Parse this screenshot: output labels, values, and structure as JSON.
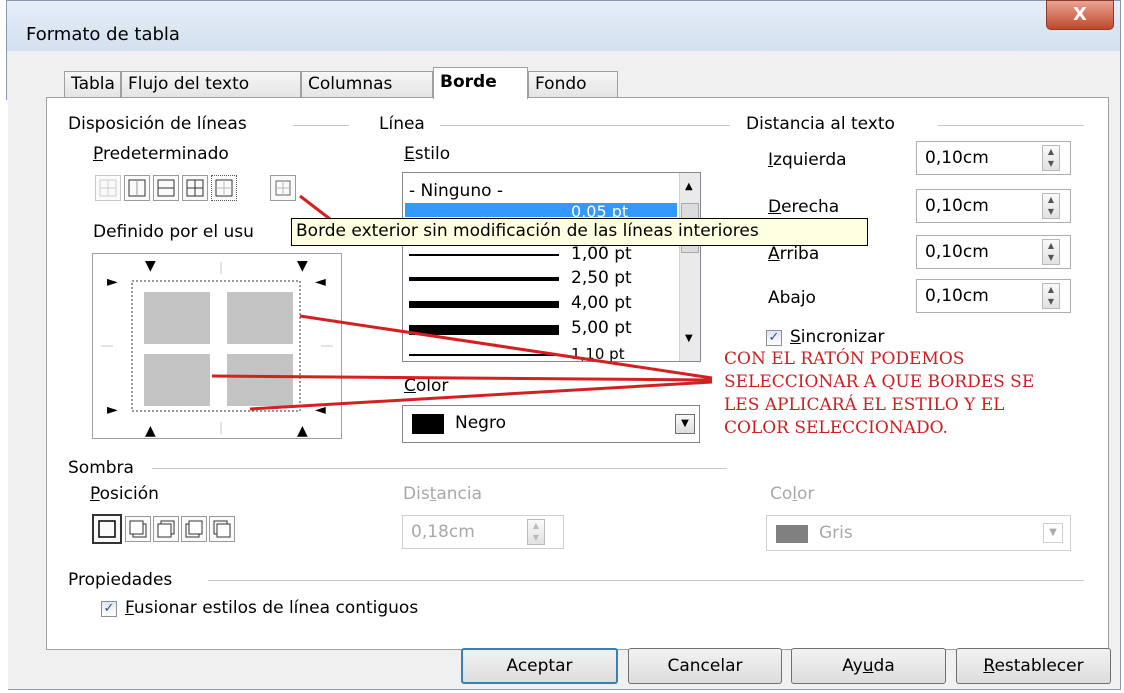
{
  "window": {
    "title": "Formato de tabla",
    "close_glyph": "X"
  },
  "tabs": [
    {
      "label": "Tabla"
    },
    {
      "label": "Flujo del texto"
    },
    {
      "label": "Columnas"
    },
    {
      "label": "Borde"
    },
    {
      "label": "Fondo"
    }
  ],
  "line_arrangement": {
    "heading": "Disposición de líneas",
    "default_label": "Predeterminado",
    "user_defined_label": "Definido por el usu",
    "preset_icons": [
      "no-border-icon",
      "outer-border-icon",
      "outer-horizontal-border-icon",
      "outer-all-lines-border-icon",
      "outer-keep-inner-border-icon"
    ]
  },
  "tooltip": "Borde exterior sin modificación de las líneas interiores",
  "line": {
    "heading": "Línea",
    "style_label": "Estilo",
    "styles": [
      "- Ninguno -",
      "0,05 pt",
      "",
      "1,00 pt",
      "2,50 pt",
      "4,00 pt",
      "5,00 pt",
      "1,10 pt"
    ],
    "selected_style": "0,05 pt",
    "color_label": "Color",
    "color_value": "Negro",
    "color_swatch": "#000000"
  },
  "spacing": {
    "heading": "Distancia al texto",
    "left_label": "Izquierda",
    "left_value": "0,10cm",
    "right_label": "Derecha",
    "right_value": "0,10cm",
    "top_label": "Arriba",
    "top_value": "0,10cm",
    "bottom_label": "Abajo",
    "bottom_value": "0,10cm",
    "sync_label": "Sincronizar",
    "sync_checked": true
  },
  "annotation": {
    "lines": [
      "CON EL RATÓN PODEMOS",
      "SELECCIONAR A QUE BORDES SE",
      "LES APLICARÁ EL ESTILO Y EL",
      "COLOR  SELECCIONADO."
    ],
    "color": "#cc1f1f"
  },
  "shadow": {
    "heading": "Sombra",
    "position_label": "Posición",
    "distance_label": "Distancia",
    "distance_value": "0,18cm",
    "color_label": "Color",
    "color_value": "Gris",
    "color_swatch": "#808080"
  },
  "properties": {
    "heading": "Propiedades",
    "merge_label": "Fusionar estilos de línea contiguos",
    "merge_checked": true
  },
  "buttons": {
    "ok": "Aceptar",
    "cancel": "Cancelar",
    "help": "Ayuda",
    "reset": "Restablecer"
  }
}
